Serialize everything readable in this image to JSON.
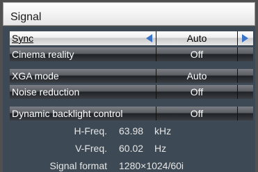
{
  "title": "Signal",
  "rows": [
    {
      "label": "Sync",
      "value": "Auto"
    },
    {
      "label": "Cinema reality",
      "value": "Off"
    },
    {
      "label": "XGA mode",
      "value": "Auto"
    },
    {
      "label": "Noise reduction",
      "value": "Off"
    },
    {
      "label": "Dynamic backlight control",
      "value": "Off"
    }
  ],
  "info": {
    "hfreq_label": "H-Freq.",
    "hfreq_value": "63.98",
    "hfreq_unit": "kHz",
    "vfreq_label": "V-Freq.",
    "vfreq_value": "60.02",
    "vfreq_unit": "Hz",
    "format_label": "Signal format",
    "format_value": "1280×1024/60i"
  },
  "colors": {
    "panel": "#3d4a55",
    "arrow": "#3a74c9"
  }
}
